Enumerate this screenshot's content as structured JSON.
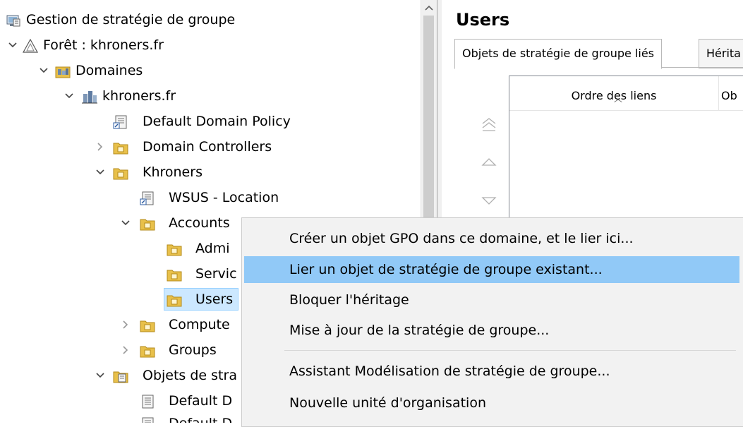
{
  "tree": {
    "root": {
      "label": "Gestion de stratégie de groupe",
      "icon": "gpmc-console-icon"
    },
    "forest": {
      "label": "Forêt : khroners.fr",
      "icon": "forest-icon"
    },
    "domains": {
      "label": "Domaines",
      "icon": "domains-icon"
    },
    "domain": {
      "label": "khroners.fr",
      "icon": "domain-icon"
    },
    "default_domain_policy": {
      "label": "Default Domain Policy",
      "icon": "gpo-link-icon"
    },
    "domain_controllers": {
      "label": "Domain Controllers",
      "icon": "ou-folder-icon"
    },
    "khroners": {
      "label": "Khroners",
      "icon": "ou-folder-icon"
    },
    "wsus_location": {
      "label": "WSUS - Location",
      "icon": "gpo-link-icon"
    },
    "accounts": {
      "label": "Accounts",
      "icon": "ou-folder-icon"
    },
    "admins": {
      "label": "Admi",
      "icon": "ou-folder-icon"
    },
    "services": {
      "label": "Servic",
      "icon": "ou-folder-icon"
    },
    "users": {
      "label": "Users",
      "icon": "ou-folder-icon",
      "selected": true
    },
    "computers": {
      "label": "Compute",
      "icon": "ou-folder-icon"
    },
    "groups": {
      "label": "Groups",
      "icon": "ou-folder-icon"
    },
    "gpo_objects": {
      "label": "Objets de stra",
      "icon": "gpo-container-icon"
    },
    "default_d1": {
      "label": "Default D",
      "icon": "gpo-icon"
    },
    "default_d2": {
      "label": "Default D",
      "icon": "gpo-icon"
    }
  },
  "right_pane": {
    "title": "Users",
    "tabs": [
      {
        "label": "Objets de stratégie de groupe liés",
        "active": true
      },
      {
        "label": "Hérita",
        "active": false
      }
    ],
    "columns": [
      {
        "label": "Ordre des liens",
        "sorted": true
      },
      {
        "label": "Ob"
      }
    ]
  },
  "context_menu": {
    "items": [
      {
        "label": "Créer un objet GPO dans ce domaine, et le lier ici...",
        "highlighted": false
      },
      {
        "label": "Lier un objet de stratégie de groupe existant...",
        "highlighted": true
      },
      {
        "label": "Bloquer l'héritage",
        "highlighted": false
      },
      {
        "label": "Mise à jour de la stratégie de groupe...",
        "highlighted": false
      },
      {
        "label": "Assistant Modélisation de stratégie de groupe...",
        "highlighted": false
      },
      {
        "label": "Nouvelle unité d'organisation",
        "highlighted": false
      }
    ]
  },
  "colors": {
    "menu_highlight": "#91c9f7",
    "selection": "#cce8ff",
    "folder": "#e8c04a"
  }
}
